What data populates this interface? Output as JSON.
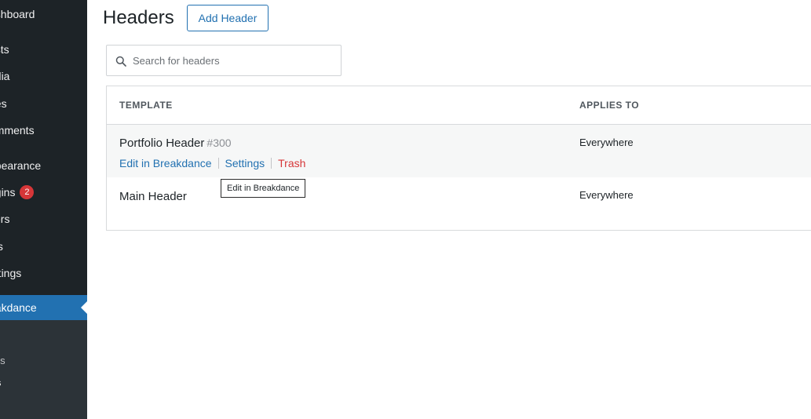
{
  "sidebar": {
    "items": [
      {
        "label": "ashboard"
      },
      {
        "label": "osts"
      },
      {
        "label": "edia"
      },
      {
        "label": "ges"
      },
      {
        "label": "omments"
      },
      {
        "label": "ppearance"
      },
      {
        "label": "ugins",
        "badge": "2"
      },
      {
        "label": "sers"
      },
      {
        "label": "ols"
      },
      {
        "label": "ettings"
      }
    ],
    "active": {
      "label": "eakdance"
    },
    "submenu": [
      {
        "label": "ates"
      },
      {
        "label": "ers"
      },
      {
        "label": "s"
      }
    ]
  },
  "page": {
    "title": "Headers",
    "add_button": "Add Header"
  },
  "search": {
    "placeholder": "Search for headers",
    "icon": "search-icon"
  },
  "table": {
    "columns": [
      "TEMPLATE",
      "APPLIES TO"
    ],
    "rows": [
      {
        "name": "Portfolio Header",
        "id": "#300",
        "applies": "Everywhere",
        "actions": {
          "edit": "Edit in Breakdance",
          "settings": "Settings",
          "trash": "Trash"
        }
      },
      {
        "name": "Main Header",
        "applies": "Everywhere"
      }
    ]
  },
  "tooltip": "Edit in Breakdance",
  "colors": {
    "accent": "#2271b1",
    "danger": "#d63638",
    "sidebar": "#1d2327"
  }
}
